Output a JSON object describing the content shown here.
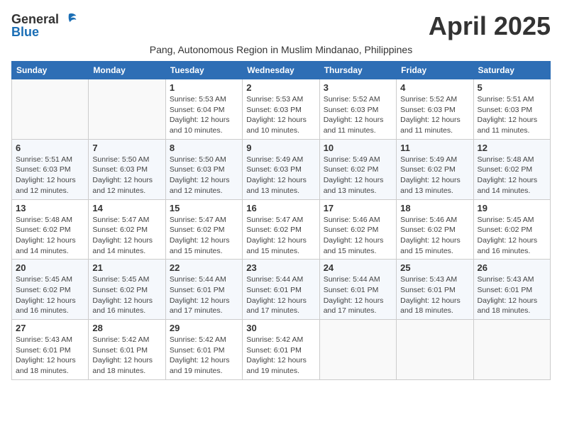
{
  "header": {
    "logo_general": "General",
    "logo_blue": "Blue",
    "month_title": "April 2025",
    "subtitle": "Pang, Autonomous Region in Muslim Mindanao, Philippines"
  },
  "calendar": {
    "days_of_week": [
      "Sunday",
      "Monday",
      "Tuesday",
      "Wednesday",
      "Thursday",
      "Friday",
      "Saturday"
    ],
    "weeks": [
      [
        {
          "day": "",
          "info": ""
        },
        {
          "day": "",
          "info": ""
        },
        {
          "day": "1",
          "info": "Sunrise: 5:53 AM\nSunset: 6:04 PM\nDaylight: 12 hours and 10 minutes."
        },
        {
          "day": "2",
          "info": "Sunrise: 5:53 AM\nSunset: 6:03 PM\nDaylight: 12 hours and 10 minutes."
        },
        {
          "day": "3",
          "info": "Sunrise: 5:52 AM\nSunset: 6:03 PM\nDaylight: 12 hours and 11 minutes."
        },
        {
          "day": "4",
          "info": "Sunrise: 5:52 AM\nSunset: 6:03 PM\nDaylight: 12 hours and 11 minutes."
        },
        {
          "day": "5",
          "info": "Sunrise: 5:51 AM\nSunset: 6:03 PM\nDaylight: 12 hours and 11 minutes."
        }
      ],
      [
        {
          "day": "6",
          "info": "Sunrise: 5:51 AM\nSunset: 6:03 PM\nDaylight: 12 hours and 12 minutes."
        },
        {
          "day": "7",
          "info": "Sunrise: 5:50 AM\nSunset: 6:03 PM\nDaylight: 12 hours and 12 minutes."
        },
        {
          "day": "8",
          "info": "Sunrise: 5:50 AM\nSunset: 6:03 PM\nDaylight: 12 hours and 12 minutes."
        },
        {
          "day": "9",
          "info": "Sunrise: 5:49 AM\nSunset: 6:03 PM\nDaylight: 12 hours and 13 minutes."
        },
        {
          "day": "10",
          "info": "Sunrise: 5:49 AM\nSunset: 6:02 PM\nDaylight: 12 hours and 13 minutes."
        },
        {
          "day": "11",
          "info": "Sunrise: 5:49 AM\nSunset: 6:02 PM\nDaylight: 12 hours and 13 minutes."
        },
        {
          "day": "12",
          "info": "Sunrise: 5:48 AM\nSunset: 6:02 PM\nDaylight: 12 hours and 14 minutes."
        }
      ],
      [
        {
          "day": "13",
          "info": "Sunrise: 5:48 AM\nSunset: 6:02 PM\nDaylight: 12 hours and 14 minutes."
        },
        {
          "day": "14",
          "info": "Sunrise: 5:47 AM\nSunset: 6:02 PM\nDaylight: 12 hours and 14 minutes."
        },
        {
          "day": "15",
          "info": "Sunrise: 5:47 AM\nSunset: 6:02 PM\nDaylight: 12 hours and 15 minutes."
        },
        {
          "day": "16",
          "info": "Sunrise: 5:47 AM\nSunset: 6:02 PM\nDaylight: 12 hours and 15 minutes."
        },
        {
          "day": "17",
          "info": "Sunrise: 5:46 AM\nSunset: 6:02 PM\nDaylight: 12 hours and 15 minutes."
        },
        {
          "day": "18",
          "info": "Sunrise: 5:46 AM\nSunset: 6:02 PM\nDaylight: 12 hours and 15 minutes."
        },
        {
          "day": "19",
          "info": "Sunrise: 5:45 AM\nSunset: 6:02 PM\nDaylight: 12 hours and 16 minutes."
        }
      ],
      [
        {
          "day": "20",
          "info": "Sunrise: 5:45 AM\nSunset: 6:02 PM\nDaylight: 12 hours and 16 minutes."
        },
        {
          "day": "21",
          "info": "Sunrise: 5:45 AM\nSunset: 6:02 PM\nDaylight: 12 hours and 16 minutes."
        },
        {
          "day": "22",
          "info": "Sunrise: 5:44 AM\nSunset: 6:01 PM\nDaylight: 12 hours and 17 minutes."
        },
        {
          "day": "23",
          "info": "Sunrise: 5:44 AM\nSunset: 6:01 PM\nDaylight: 12 hours and 17 minutes."
        },
        {
          "day": "24",
          "info": "Sunrise: 5:44 AM\nSunset: 6:01 PM\nDaylight: 12 hours and 17 minutes."
        },
        {
          "day": "25",
          "info": "Sunrise: 5:43 AM\nSunset: 6:01 PM\nDaylight: 12 hours and 18 minutes."
        },
        {
          "day": "26",
          "info": "Sunrise: 5:43 AM\nSunset: 6:01 PM\nDaylight: 12 hours and 18 minutes."
        }
      ],
      [
        {
          "day": "27",
          "info": "Sunrise: 5:43 AM\nSunset: 6:01 PM\nDaylight: 12 hours and 18 minutes."
        },
        {
          "day": "28",
          "info": "Sunrise: 5:42 AM\nSunset: 6:01 PM\nDaylight: 12 hours and 18 minutes."
        },
        {
          "day": "29",
          "info": "Sunrise: 5:42 AM\nSunset: 6:01 PM\nDaylight: 12 hours and 19 minutes."
        },
        {
          "day": "30",
          "info": "Sunrise: 5:42 AM\nSunset: 6:01 PM\nDaylight: 12 hours and 19 minutes."
        },
        {
          "day": "",
          "info": ""
        },
        {
          "day": "",
          "info": ""
        },
        {
          "day": "",
          "info": ""
        }
      ]
    ]
  }
}
